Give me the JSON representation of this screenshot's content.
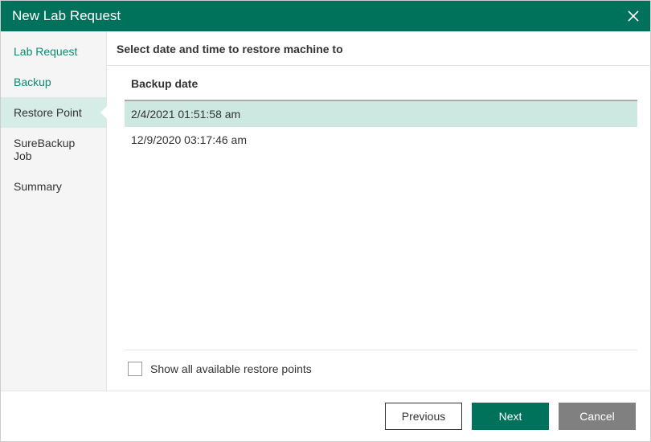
{
  "title": "New Lab Request",
  "sidebar": {
    "items": [
      {
        "label": "Lab Request",
        "state": "visited"
      },
      {
        "label": "Backup",
        "state": "visited"
      },
      {
        "label": "Restore Point",
        "state": "active"
      },
      {
        "label": "SureBackup Job",
        "state": "pending"
      },
      {
        "label": "Summary",
        "state": "pending"
      }
    ]
  },
  "main": {
    "heading": "Select date and time to restore machine to",
    "column_header": "Backup date",
    "rows": [
      {
        "label": "2/4/2021 01:51:58 am",
        "selected": true
      },
      {
        "label": "12/9/2020 03:17:46 am",
        "selected": false
      }
    ],
    "show_all_label": "Show all available restore points",
    "show_all_checked": false
  },
  "footer": {
    "previous": "Previous",
    "next": "Next",
    "cancel": "Cancel"
  }
}
